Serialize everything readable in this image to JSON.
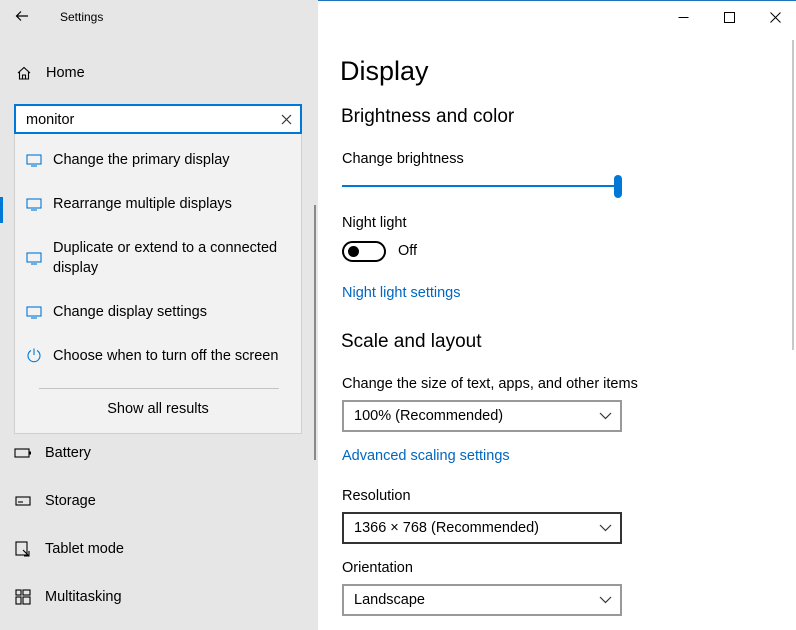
{
  "window": {
    "title": "Settings",
    "controls": [
      "minimize-icon",
      "maximize-icon",
      "close-icon"
    ]
  },
  "sidebar": {
    "home_label": "Home",
    "search": {
      "value": "monitor"
    },
    "suggestions": [
      {
        "label": "Change the primary display",
        "icon": "monitor-icon"
      },
      {
        "label": "Rearrange multiple displays",
        "icon": "monitor-icon"
      },
      {
        "label": "Duplicate or extend to a connected display",
        "icon": "monitor-icon"
      },
      {
        "label": "Change display settings",
        "icon": "monitor-icon"
      },
      {
        "label": "Choose when to turn off the screen",
        "icon": "power-icon"
      }
    ],
    "show_all": "Show all results",
    "items": [
      {
        "label": "Battery",
        "icon": "battery-icon"
      },
      {
        "label": "Storage",
        "icon": "storage-icon"
      },
      {
        "label": "Tablet mode",
        "icon": "tablet-mode-icon"
      },
      {
        "label": "Multitasking",
        "icon": "multitasking-icon"
      }
    ]
  },
  "main": {
    "title": "Display",
    "brightness": {
      "heading": "Brightness and color",
      "label": "Change brightness",
      "value_fraction": 1.0
    },
    "night_light": {
      "label": "Night light",
      "state": "Off",
      "settings_link": "Night light settings"
    },
    "scale": {
      "heading": "Scale and layout",
      "size_label": "Change the size of text, apps, and other items",
      "size_value": "100% (Recommended)",
      "advanced_link": "Advanced scaling settings",
      "resolution_label": "Resolution",
      "resolution_value": "1366 × 768 (Recommended)",
      "orientation_label": "Orientation",
      "orientation_value": "Landscape"
    }
  },
  "colors": {
    "accent": "#0078d7",
    "link": "#0067c0",
    "sidebar_bg": "#e6e6e6"
  }
}
